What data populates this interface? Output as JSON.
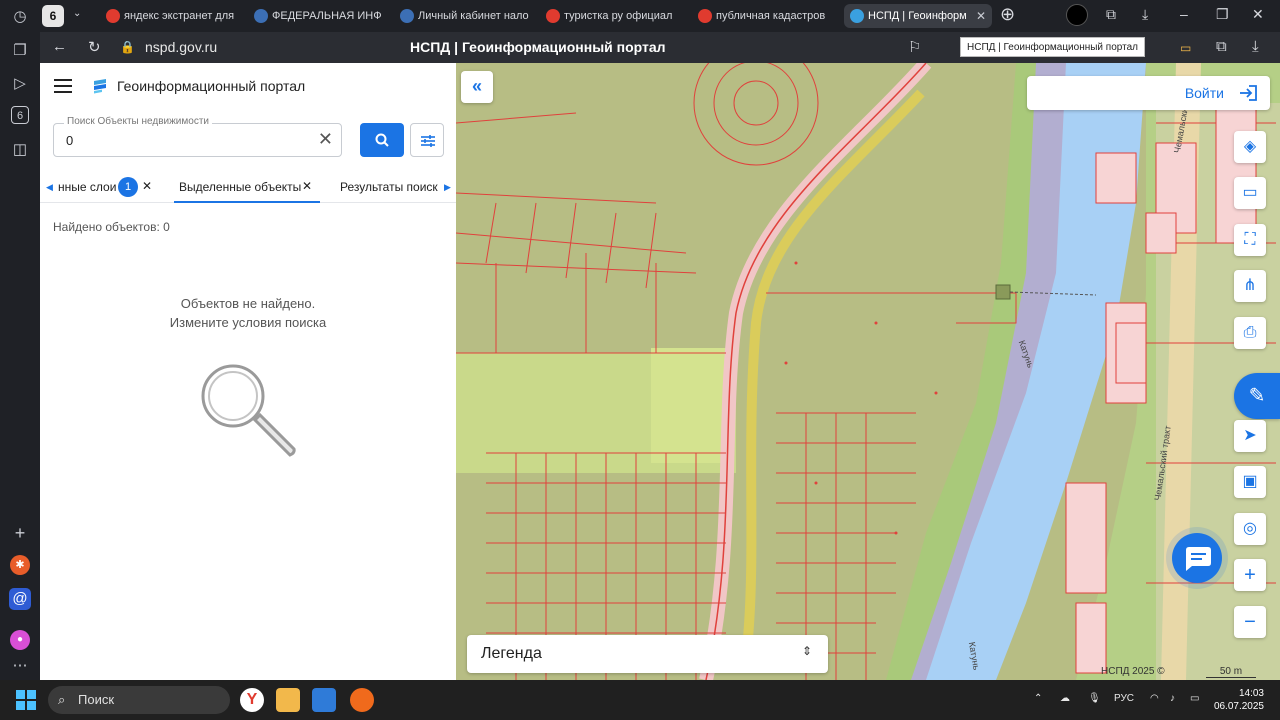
{
  "browser": {
    "tab_count": "6",
    "tabs": [
      {
        "label": "яндекс экстранет для",
        "favicon_color": "#e03b2f"
      },
      {
        "label": "ФЕДЕРАЛЬНАЯ ИНФ",
        "favicon_color": "#3c6fb5"
      },
      {
        "label": "Личный кабинет нало",
        "favicon_color": "#3c6fb5"
      },
      {
        "label": "туристка ру официал",
        "favicon_color": "#e03b2f"
      },
      {
        "label": "публичная кадастров",
        "favicon_color": "#e03b2f"
      },
      {
        "label": "НСПД | Геоинформ",
        "favicon_color": "#3aa0e0",
        "active": true
      }
    ],
    "url": "nspd.gov.ru",
    "page_title": "НСПД | Геоинформационный портал",
    "tooltip": "НСПД | Геоинформационный портал",
    "rail_badge": "6"
  },
  "panel": {
    "app_title": "Геоинформационный портал",
    "search": {
      "label": "Поиск Объекты недвижимости",
      "value": "0"
    },
    "tabs": [
      {
        "label": "нные слои",
        "badge": "1"
      },
      {
        "label": "Выделенные объекты",
        "active": true
      },
      {
        "label": "Результаты поиска"
      }
    ],
    "found_label": "Найдено объектов: 0",
    "empty_title": "Объектов не найдено.",
    "empty_hint": "Измените условия поиска"
  },
  "map": {
    "login_label": "Войти",
    "legend_label": "Легенда",
    "copyright": "НСПД 2025 ©",
    "scale_label": "50 m",
    "labels": {
      "river": "Катунь",
      "river2": "Катунь",
      "road": "Чемальский тракт",
      "road2": "Чемальский"
    },
    "colors": {
      "accent": "#1b74e4",
      "parcel_fill": "#b7bd84",
      "parcel_line": "#e0413c",
      "water": "#a8d0f5",
      "meadow": "#d4e38f"
    }
  },
  "taskbar": {
    "search_placeholder": "Поиск",
    "language": "РУС",
    "time": "14:03",
    "date": "06.07.2025"
  }
}
